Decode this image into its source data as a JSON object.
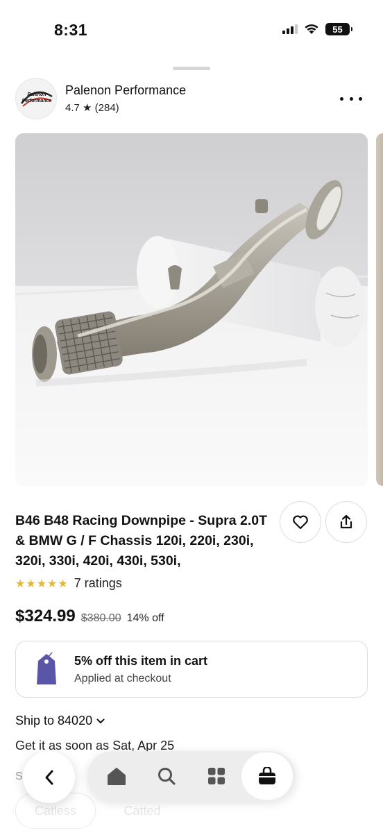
{
  "status_bar": {
    "time": "8:31",
    "battery": "55",
    "icons": [
      "cellular-signal-icon",
      "wifi-icon",
      "battery-icon"
    ]
  },
  "shop": {
    "logo_text_top": "Palenon",
    "logo_text_bottom": "Performance",
    "name": "Palenon Performance",
    "rating": "4.7 ★ (284)",
    "more_icon": "more-horizontal-icon"
  },
  "product": {
    "title": "B46 B48 Racing Downpipe - Supra 2.0T & BMW G / F Chassis 120i, 220i, 230i, 320i, 330i, 420i, 430i, 530i,",
    "image_subject": "stainless-steel-downpipe-photo",
    "favorite_icon": "heart-icon",
    "share_icon": "share-icon",
    "stars": "★★★★★",
    "ratings_label": "7 ratings",
    "price": "$324.99",
    "old_price": "$380.00",
    "discount": "14% off"
  },
  "promo": {
    "icon": "price-tag-icon",
    "title": "5% off this item in cart",
    "subtitle": "Applied at checkout"
  },
  "shipping": {
    "ship_to": "Ship to 84020",
    "chevron_icon": "chevron-down-icon",
    "estimate": "Get it as soon as Sat, Apr 25"
  },
  "variants": {
    "label": "S",
    "options": [
      "Catless",
      "Catted"
    ]
  },
  "bottom_nav": {
    "back_icon": "chevron-left-icon",
    "items": [
      "home-icon",
      "search-icon",
      "categories-icon",
      "cart-icon"
    ],
    "active": "cart-icon"
  },
  "colors": {
    "accent_star": "#e6b82e",
    "promo_tag": "#5b55a8",
    "text_primary": "#111111"
  }
}
